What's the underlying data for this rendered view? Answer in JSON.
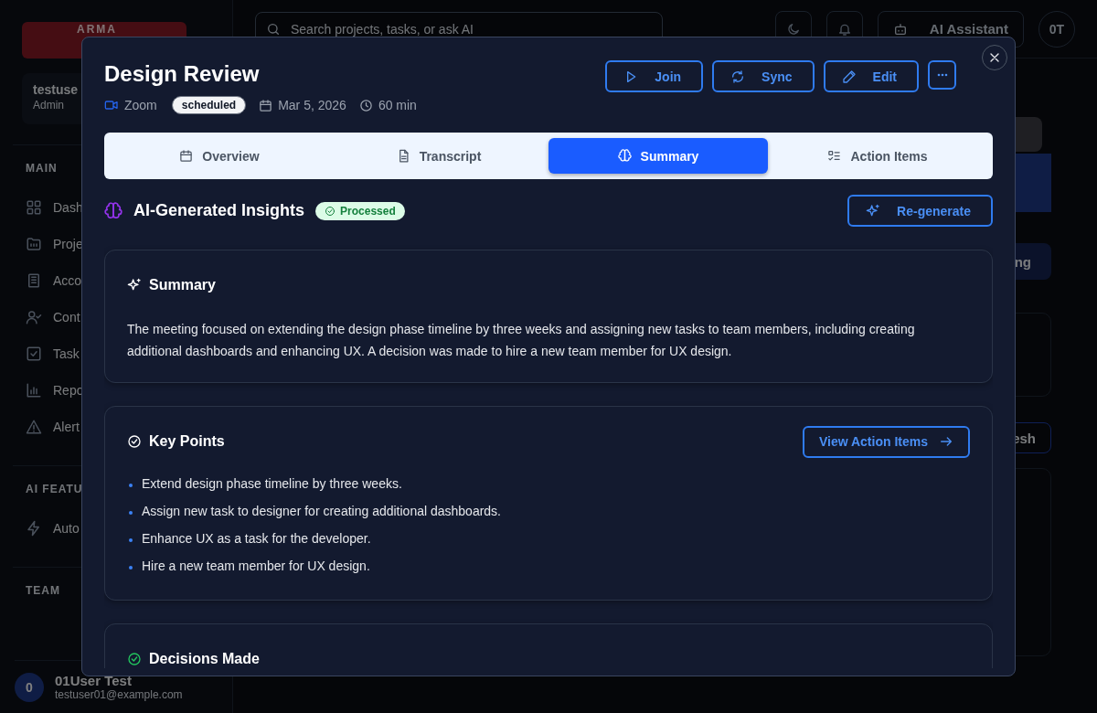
{
  "app": {
    "logo": "ARMA",
    "user": {
      "name": "testuse",
      "role": "Admin"
    },
    "sections": [
      {
        "label": "MAIN",
        "items": [
          {
            "label": "Dash"
          },
          {
            "label": "Proje"
          },
          {
            "label": "Acco"
          },
          {
            "label": "Cont"
          },
          {
            "label": "Task"
          },
          {
            "label": "Repo"
          },
          {
            "label": "Alert"
          }
        ]
      },
      {
        "label": "AI FEATU",
        "items": [
          {
            "label": "Auto"
          }
        ]
      },
      {
        "label": "TEAM"
      }
    ],
    "footer_user": {
      "initial": "0",
      "name": "01User Test",
      "email": "testuser01@example.com"
    },
    "search": {
      "placeholder": "Search projects, tasks, or ask AI"
    },
    "header": {
      "assistant": "AI Assistant",
      "avatar": "0T"
    },
    "fragments": [
      {
        "kind": "button",
        "text": "ng"
      },
      {
        "kind": "outline",
        "text": "esh"
      }
    ]
  },
  "modal": {
    "title": "Design Review",
    "platform": "Zoom",
    "status": "scheduled",
    "date": "Mar 5, 2026",
    "duration": "60 min",
    "actions": [
      {
        "kind": "join",
        "label": "Join"
      },
      {
        "kind": "sync",
        "label": "Sync"
      },
      {
        "kind": "edit",
        "label": "Edit"
      },
      {
        "kind": "more"
      }
    ],
    "tabs": [
      {
        "kind": "calendar",
        "label": "Overview",
        "selected": false
      },
      {
        "kind": "doc",
        "label": "Transcript",
        "selected": false
      },
      {
        "kind": "brain",
        "label": "Summary",
        "selected": true
      },
      {
        "kind": "list",
        "label": "Action Items",
        "selected": false
      }
    ],
    "insights": {
      "title": "AI-Generated Insights",
      "badge": "Processed",
      "regenerate": "Re-generate"
    },
    "summary": {
      "heading": "Summary",
      "text": "The meeting focused on extending the design phase timeline by three weeks and assigning new tasks to team members, including creating additional dashboards and enhancing UX. A decision was made to hire a new team member for UX design."
    },
    "key_points": {
      "heading": "Key Points",
      "button": "View Action Items",
      "items": [
        "Extend design phase timeline by three weeks.",
        "Assign new task to designer for creating additional dashboards.",
        "Enhance UX as a task for the developer.",
        "Hire a new team member for UX design."
      ]
    },
    "decisions": {
      "heading": "Decisions Made"
    }
  }
}
